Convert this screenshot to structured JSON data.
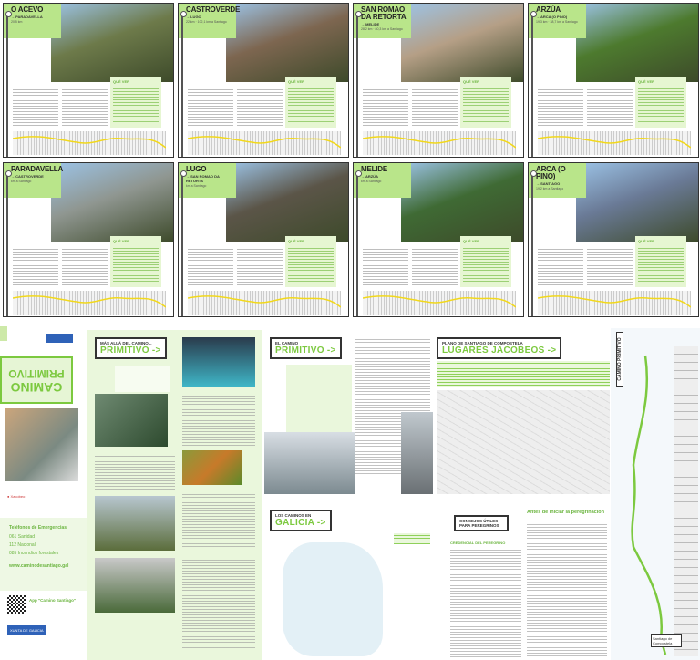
{
  "stages": [
    {
      "title": "O ACEVO",
      "dest": "→ PARADAVELLA",
      "meta": "20,5 km",
      "photo": "#6d7a4a"
    },
    {
      "title": "CASTROVERDE",
      "dest": "→ LUGO",
      "meta": "22 km · 102,1 km a Santiago",
      "photo": "#7d6650"
    },
    {
      "title": "SAN ROMAO DA RETORTA",
      "dest": "→ MELIDE",
      "meta": "28,2 km · 80,3 km a Santiago",
      "photo": "#b59f86"
    },
    {
      "title": "ARZÚA",
      "dest": "→ ARCA (O PINO)",
      "meta": "19,3 km · 38,7 km a Santiago",
      "photo": "#4d7a2e"
    },
    {
      "title": "PARADAVELLA",
      "dest": "→ CASTROVERDE",
      "meta": "km a Santiago",
      "photo": "#8f9690"
    },
    {
      "title": "LUGO",
      "dest": "→ SAN ROMAO DA RETORTA",
      "meta": "km a Santiago",
      "photo": "#5b5548"
    },
    {
      "title": "MELIDE",
      "dest": "→ ARZÚA",
      "meta": "km a Santiago",
      "photo": "#3f6a34"
    },
    {
      "title": "ARCA (O PINO)",
      "dest": "→ SANTIAGO",
      "meta": "19,2 km a Santiago",
      "photo": "#6a7a96"
    }
  ],
  "que_ver": "QUÉ VER",
  "cover": {
    "title1": "CAMINO",
    "title2": "PRIMITIVO",
    "brand": "XUNTA DE GALICIA"
  },
  "emergency": {
    "title": "Teléfonos de Emergencias",
    "lines": [
      "061 Sanidad",
      "112 Nacional",
      "085 Incendios forestales"
    ],
    "web": "www.caminodesantiago.gal",
    "app": "App \"Camino Santiago\""
  },
  "mas_alla": {
    "pre": "MÁS ALLÁ DEL CAMINO...",
    "title": "PRIMITIVO ->"
  },
  "el_camino": {
    "pre": "EL CAMINO",
    "title": "PRIMITIVO ->"
  },
  "plano": {
    "pre": "PLANO DE SANTIAGO DE COMPOSTELA",
    "title": "LUGARES JACOBEOS ->"
  },
  "caminos": {
    "pre": "LOS CAMINOS EN",
    "title": "GALICIA ->"
  },
  "consejos": {
    "title": "CONSEJOS ÚTILES PARA PEREGRINOS",
    "sub": "CREDENCIAL DEL PEREGRINO",
    "antes": "Antes de iniciar la peregrinación"
  },
  "strip": {
    "title": "CAMINO PRIMITIVO",
    "end": "Santiago de Compostela"
  }
}
